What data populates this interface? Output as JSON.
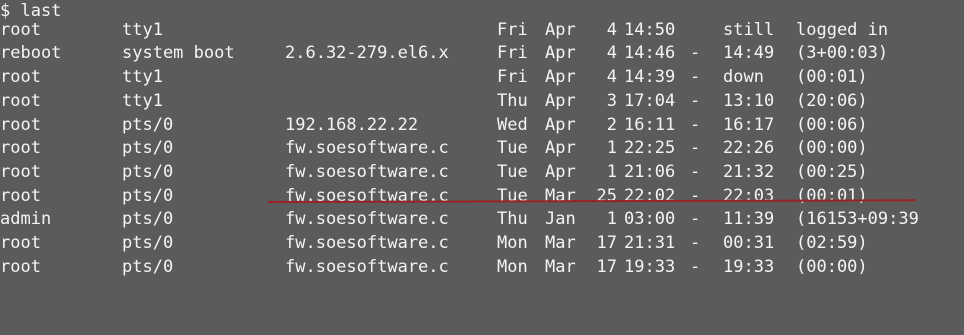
{
  "terminal": {
    "prompt": "$ last",
    "accent_color": "#9a2222",
    "rows": [
      {
        "user": "root",
        "tty": "tty1",
        "host": "",
        "day": "Fri",
        "month": "Apr",
        "date": "4",
        "login": "14:50",
        "dash": "",
        "logout": "still",
        "duration": "logged in"
      },
      {
        "user": "reboot",
        "tty": "system boot",
        "host": "2.6.32-279.el6.x",
        "day": "Fri",
        "month": "Apr",
        "date": "4",
        "login": "14:46",
        "dash": "-",
        "logout": "14:49",
        "duration": "(3+00:03)"
      },
      {
        "user": "root",
        "tty": "tty1",
        "host": "",
        "day": "Fri",
        "month": "Apr",
        "date": "4",
        "login": "14:39",
        "dash": "-",
        "logout": "down",
        "duration": "(00:01)"
      },
      {
        "user": "root",
        "tty": "tty1",
        "host": "",
        "day": "Thu",
        "month": "Apr",
        "date": "3",
        "login": "17:04",
        "dash": "-",
        "logout": "13:10",
        "duration": "(20:06)"
      },
      {
        "user": "root",
        "tty": "pts/0",
        "host": "192.168.22.22",
        "day": "Wed",
        "month": "Apr",
        "date": "2",
        "login": "16:11",
        "dash": "-",
        "logout": "16:17",
        "duration": "(00:06)"
      },
      {
        "user": "root",
        "tty": "pts/0",
        "host": "fw.soesoftware.c",
        "day": "Tue",
        "month": "Apr",
        "date": "1",
        "login": "22:25",
        "dash": "-",
        "logout": "22:26",
        "duration": "(00:00)"
      },
      {
        "user": "root",
        "tty": "pts/0",
        "host": "fw.soesoftware.c",
        "day": "Tue",
        "month": "Apr",
        "date": "1",
        "login": "21:06",
        "dash": "-",
        "logout": "21:32",
        "duration": "(00:25)"
      },
      {
        "user": "root",
        "tty": "pts/0",
        "host": "fw.soesoftware.c",
        "day": "Tue",
        "month": "Mar",
        "date": "25",
        "login": "22:02",
        "dash": "-",
        "logout": "22:03",
        "duration": "(00:01)"
      },
      {
        "user": "admin",
        "tty": "pts/0",
        "host": "fw.soesoftware.c",
        "day": "Thu",
        "month": "Jan",
        "date": "1",
        "login": "03:00",
        "dash": "-",
        "logout": "11:39",
        "duration": "(16153+09:39"
      },
      {
        "user": "root",
        "tty": "pts/0",
        "host": "fw.soesoftware.c",
        "day": "Mon",
        "month": "Mar",
        "date": "17",
        "login": "21:31",
        "dash": "-",
        "logout": "00:31",
        "duration": "(02:59)"
      },
      {
        "user": "root",
        "tty": "pts/0",
        "host": "fw.soesoftware.c",
        "day": "Mon",
        "month": "Mar",
        "date": "17",
        "login": "19:33",
        "dash": "-",
        "logout": "19:33",
        "duration": "(00:00)"
      }
    ]
  }
}
